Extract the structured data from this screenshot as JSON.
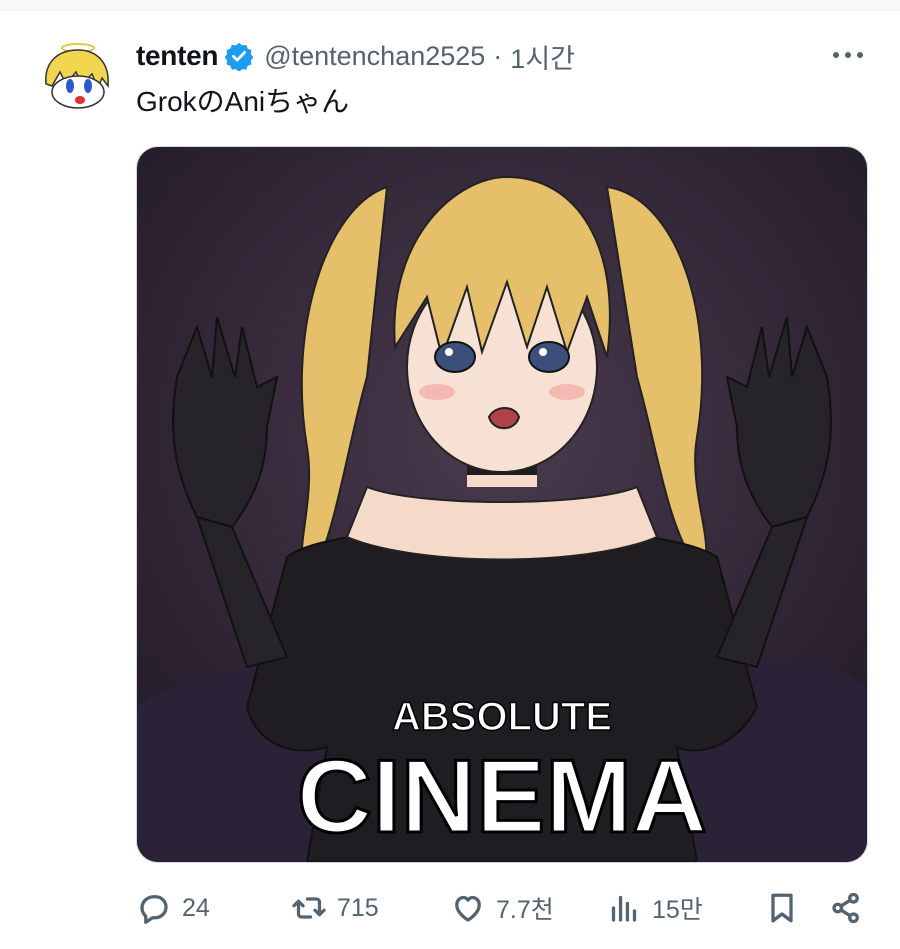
{
  "tweet": {
    "display_name": "tenten",
    "handle": "@tentenchan2525",
    "separator": "·",
    "time": "1시간",
    "text": "GrokのAniちゃん",
    "media": {
      "caption_top": "ABSOLUTE",
      "caption_bottom": "CINEMA"
    }
  },
  "actions": {
    "replies": "24",
    "reposts": "715",
    "likes": "7.7천",
    "views": "15만"
  },
  "colors": {
    "verified": "#1d9bf0",
    "secondary_text": "#536471",
    "border": "#cfd9de",
    "media_bg": "#2e2434"
  },
  "icons": [
    "verified-badge-icon",
    "more-icon",
    "reply-icon",
    "repost-icon",
    "like-icon",
    "views-icon",
    "bookmark-icon",
    "share-icon"
  ]
}
